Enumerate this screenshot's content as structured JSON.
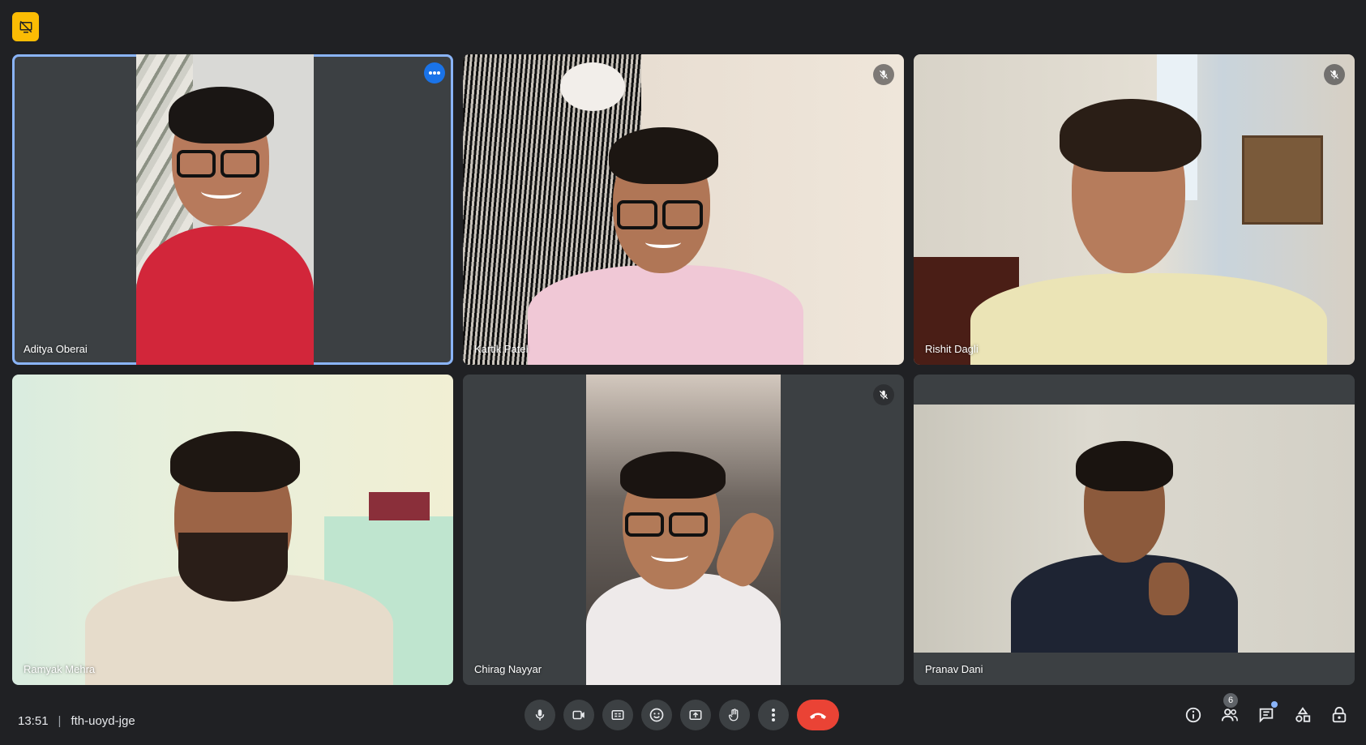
{
  "top_badge": {
    "icon": "presentation-off-icon"
  },
  "participants": [
    {
      "name": "Aditya Oberai",
      "muted": false,
      "active": true,
      "icon": "more-options-icon"
    },
    {
      "name": "Kartik Patel",
      "muted": true,
      "active": false,
      "icon": "mic-off-icon"
    },
    {
      "name": "Rishit Dagli",
      "muted": true,
      "active": false,
      "icon": "mic-off-icon"
    },
    {
      "name": "Ramyak Mehra",
      "muted": false,
      "active": false
    },
    {
      "name": "Chirag Nayyar",
      "muted": true,
      "active": false,
      "icon": "mic-off-icon"
    },
    {
      "name": "Pranav Dani",
      "muted": false,
      "active": false
    }
  ],
  "meeting": {
    "time": "13:51",
    "separator": "|",
    "code": "fth-uoyd-jge"
  },
  "controls": [
    {
      "name": "microphone",
      "icon": "mic-icon"
    },
    {
      "name": "camera",
      "icon": "camera-icon"
    },
    {
      "name": "captions",
      "icon": "captions-icon"
    },
    {
      "name": "reactions",
      "icon": "emoji-icon"
    },
    {
      "name": "present",
      "icon": "present-icon"
    },
    {
      "name": "raise-hand",
      "icon": "hand-icon"
    },
    {
      "name": "more",
      "icon": "more-vert-icon"
    },
    {
      "name": "leave-call",
      "icon": "hangup-icon"
    }
  ],
  "right_panel": {
    "people_count": "6",
    "icons": [
      "info-icon",
      "people-icon",
      "chat-icon",
      "activities-icon",
      "host-controls-icon"
    ]
  },
  "colors": {
    "background": "#202124",
    "tile": "#3c4043",
    "active_outline": "#8ab4f8",
    "hangup": "#ea4335",
    "badge": "#fbbc04"
  }
}
